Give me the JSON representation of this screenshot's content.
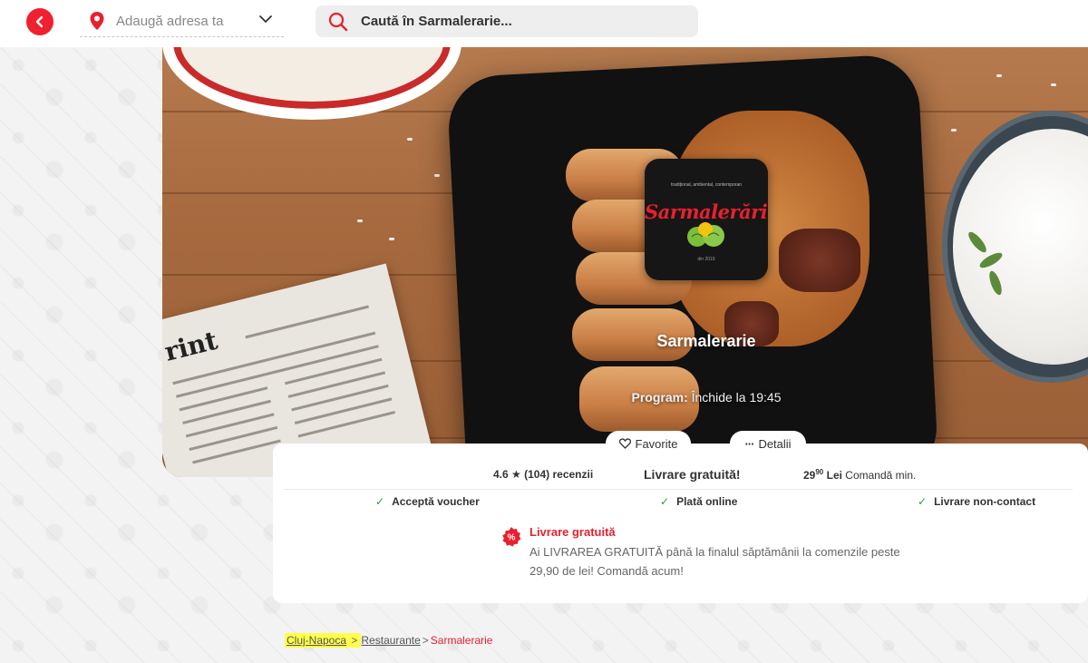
{
  "header": {
    "address_placeholder": "Adaugă adresa ta",
    "search_placeholder": "Caută în Sarmalerarie..."
  },
  "restaurant": {
    "name": "Sarmalerarie",
    "logo_wordmark": "Sarmalerărie",
    "logo_tagline": "tradițional, ambiental, contemporan",
    "logo_since": "din 2019",
    "program_label": "Program:",
    "program_value": "Închide la 19:45"
  },
  "actions": {
    "favorite_label": "Favorite",
    "details_label": "Detalii"
  },
  "stats": {
    "rating": "4.6",
    "reviews": "(104) recenzii",
    "delivery": "Livrare gratuită!",
    "min_order_int": "29",
    "min_order_dec": "90",
    "min_order_currency": "Lei",
    "min_order_label": "Comandă min."
  },
  "features": [
    "Acceptă voucher",
    "Plată online",
    "Livrare non-contact"
  ],
  "promo": {
    "badge": "%",
    "title": "Livrare gratuită",
    "text": "Ai LIVRAREA GRATUITĂ până la finalul săptămânii la comenzile peste 29,90 de lei! Comandă acum!"
  },
  "breadcrumb": {
    "city": "Cluj-Napoca",
    "category": "Restaurante",
    "current": "Sarmalerarie",
    "separator": ">"
  },
  "colors": {
    "brand_red": "#f0202e",
    "check_green": "#2a9d2a",
    "highlight": "#ffff4a"
  }
}
